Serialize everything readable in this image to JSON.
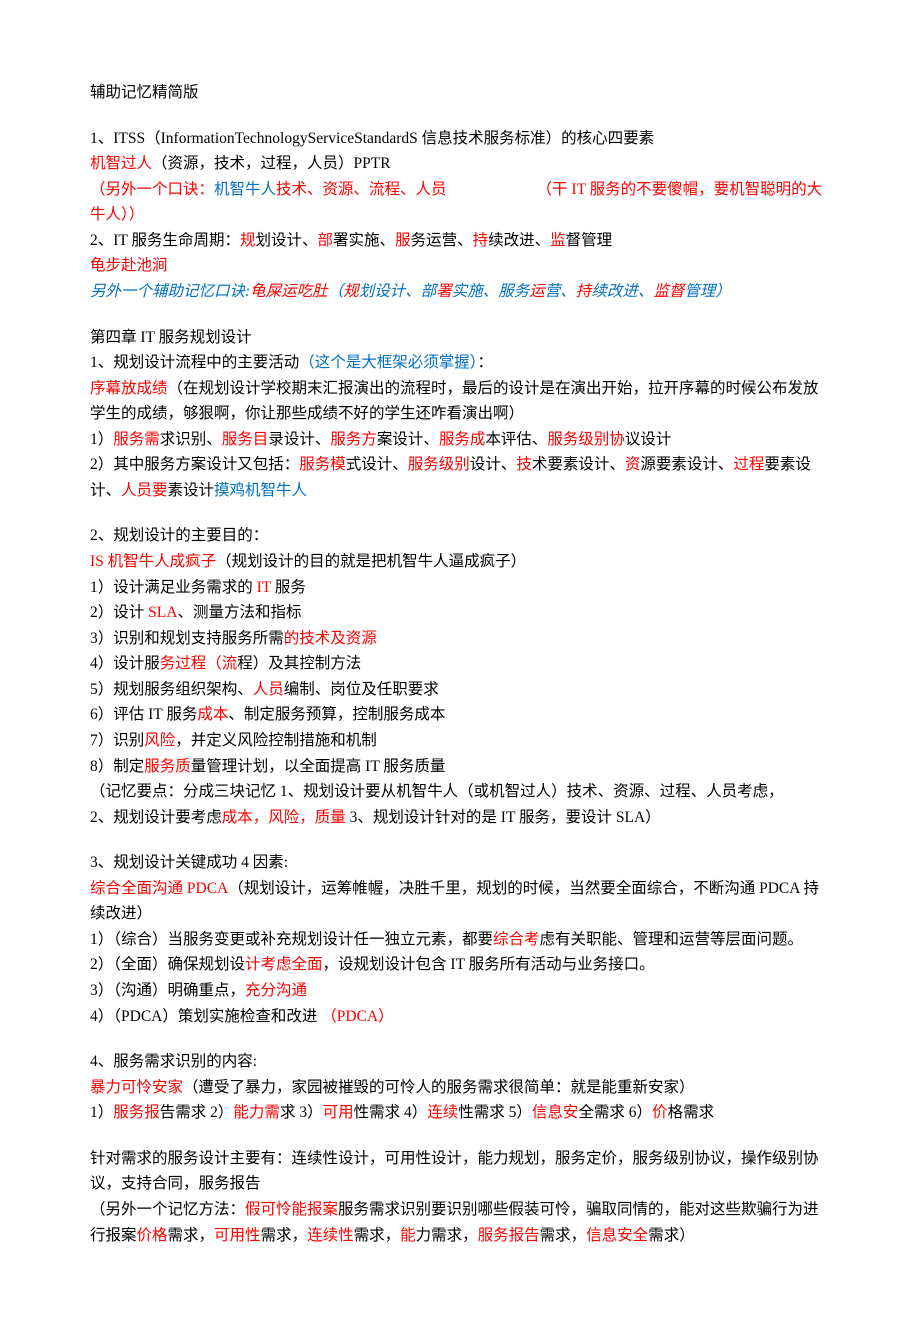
{
  "title": "辅助记忆精简版",
  "sec1": {
    "l1a": "1、ITSS（InformationTechnologyServiceStandardS 信息技术服务标准）的核心四要素",
    "l2r": "机智过人",
    "l2b": "（资源，技术，过程，人员）PPTR",
    "l3a": "（另外一个口诀：",
    "l3b": "机智牛人",
    "l3c": "技术、资源、流程、人员",
    "l3d": "（干 IT 服务的不要傻帽，要机智聪明的大牛人））",
    "l4a": "2、IT 服务生命周期：",
    "l4b": "规",
    "l4c": "划设计、",
    "l4d": "部",
    "l4e": "署实施、",
    "l4f": "服",
    "l4g": "务运营、",
    "l4h": "持",
    "l4i": "续改进、",
    "l4j": "监",
    "l4k": "督管理",
    "l5": "龟步赴池涧",
    "l6a": "另外一个辅助记忆口诀:",
    "l6b": "龟屎运吃肚",
    "l6c": "（",
    "l6d": "规",
    "l6e": "划设计、部",
    "l6f": "署",
    "l6g": "实施、服务",
    "l6h": "运",
    "l6i": "营、",
    "l6j": "持",
    "l6k": "续改进、",
    "l6l": "监督",
    "l6m": "管理）"
  },
  "sec2": {
    "title": "第四章 IT 服务规划设计",
    "l1a": "1、规划设计流程中的主要活动",
    "l1b": "（这个是大框架必须掌握）",
    "l1c": "：",
    "l2a": "序幕放成绩",
    "l2b": "（在规划设计学校期末汇报演出的流程时，最后的设计是在演出开始，拉开序幕的时候公布发放学生的成绩，够狠啊，你让那些成绩不好的学生还咋看演出啊）",
    "l3a": "1）",
    "l3b": "服务需",
    "l3c": "求识别、",
    "l3d": "服务目",
    "l3e": "录设计、",
    "l3f": "服务方",
    "l3g": "案设计、",
    "l3h": "服务成",
    "l3i": "本评估、",
    "l3j": "服务级别协",
    "l3k": "议设计",
    "l4a": "2）其中服务方案设计又包括：",
    "l4b": "服务模",
    "l4c": "式设计、",
    "l4d": "服务级别",
    "l4e": "设计、",
    "l4f": "技",
    "l4g": "术要素设计、",
    "l4h": "资",
    "l4i": "源要素设计、",
    "l4j": "过程",
    "l4k": "要素设计、",
    "l4l": "人员要",
    "l4m": "素设计",
    "l4n": "摸鸡机智牛人"
  },
  "sec3": {
    "l1": "2、规划设计的主要目的：",
    "l2a": "IS 机智牛人成疯子",
    "l2b": "（规划设计的目的就是把机智牛人逼成疯子）",
    "l3a": "1）设计满足业务需求的 ",
    "l3b": "IT ",
    "l3c": "服务",
    "l4a": "2）设计 ",
    "l4b": "SLA",
    "l4c": "、测量方法和指标",
    "l5a": "3）识别和规划支持服务所需",
    "l5b": "的技术及资源",
    "l6a": "4）设计服",
    "l6b": "务过程（流",
    "l6c": "程）及其控制方法",
    "l7a": "5）规划服务组织架构、",
    "l7b": "人员",
    "l7c": "编制、岗位及任职要求",
    "l8a": "6）评估 IT 服务",
    "l8b": "成本",
    "l8c": "、制定服务预算，控制服务成本",
    "l9a": "7）识别",
    "l9b": "风险",
    "l9c": "，并定义风险控制措施和机制",
    "l10a": "8）制定",
    "l10b": "服务质",
    "l10c": "量管理计划，以全面提高 IT 服务质量",
    "l11": "（记忆要点：分成三块记忆 1、规划设计要从机智牛人（或机智过人）技术、资源、过程、人员考虑，",
    "l12a": "2、规划设计要考虑",
    "l12b": "成本，风险，质量 ",
    "l12c": "3、规划设计针对的是 IT 服务，要设计 SLA）"
  },
  "sec4": {
    "l1": "3、规划设计关键成功 4 因素:",
    "l2a": "综合全面沟通 PDCA",
    "l2b": "（规划设计，运筹帷幄，决胜千里，规划的时候，当然要全面综合，不断沟通 PDCA 持续改进）",
    "l3a": "1）（综合）当服务变更或补充规划设计任一独立元素，都要",
    "l3b": "综合考",
    "l3c": "虑有关职能、管理和运营等层面问题。",
    "l4a": "2）（全面）确保规划设",
    "l4b": "计考虑全面",
    "l4c": "，设规划设计包含 IT 服务所有活动与业务接口。",
    "l5a": "3）（沟通）明确重点，",
    "l5b": "充分沟通",
    "l6a": "4）（PDCA）策划实施检查和改进 ",
    "l6b": "（PDCA）"
  },
  "sec5": {
    "l1": "4、服务需求识别的内容:",
    "l2a": "暴力可怜安家",
    "l2b": "（遭受了暴力，家园被摧毁的可怜人的服务需求很简单：就是能重新安家）",
    "l3a": "1）",
    "l3b": "服务报",
    "l3c": "告需求 2）",
    "l3d": "能力需",
    "l3e": "求 3）",
    "l3f": "可用",
    "l3g": "性需求 4）",
    "l3h": "连续",
    "l3i": "性需求 5）",
    "l3j": "信息安",
    "l3k": "全需求 6）",
    "l3l": "价",
    "l3m": "格需求"
  },
  "sec6": {
    "l1": "针对需求的服务设计主要有：连续性设计，可用性设计，能力规划，服务定价，服务级别协议，操作级别协议，支持合同，服务报告",
    "l2a": "（另外一个记忆方法：",
    "l2b": "假可怜能报案",
    "l2c": "服务需求识别要识别哪些假装可怜，骗取同情的，能对这些欺骗行为进行报案",
    "l2d": "价格",
    "l2e": "需求，",
    "l2f": "可用性",
    "l2g": "需求，",
    "l2h": "连续性",
    "l2i": "需求，",
    "l2j": "能",
    "l2k": "力需求，",
    "l2l": "服务报告",
    "l2m": "需求，",
    "l2n": "信息安全",
    "l2o": "需求）"
  }
}
